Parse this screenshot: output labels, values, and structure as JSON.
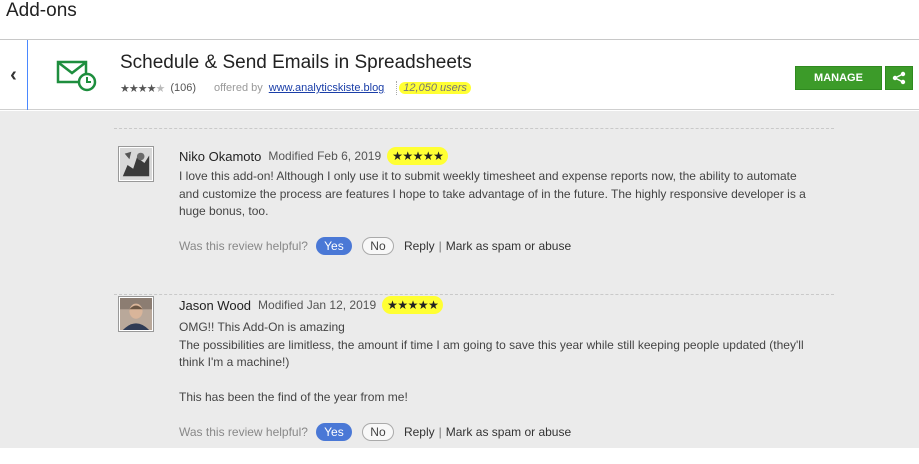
{
  "page": {
    "title": "Add-ons"
  },
  "addon": {
    "title": "Schedule & Send Emails in Spreadsheets",
    "stars_on": "★★★★",
    "stars_off": "★",
    "rating_count": "(106)",
    "offered_by": "offered by",
    "developer": "www.analyticskiste.blog",
    "users": "12,050 users",
    "manage_label": "MANAGE",
    "back_glyph": "‹"
  },
  "colors": {
    "accent_green": "#3c9b29",
    "highlight": "#ffff33",
    "yes_blue": "#4a78d6"
  },
  "icons": [
    "chevron-left-icon",
    "email-clock-icon",
    "share-icon"
  ],
  "reviews": [
    {
      "name": "Niko Okamoto",
      "modified": "Modified Feb 6, 2019",
      "stars": "★★★★★",
      "text": "I love this add-on! Although I only use it to submit weekly timesheet and expense reports now, the ability to automate and customize the process are features I hope to take advantage of in the future. The highly responsive developer is a huge bonus, too.",
      "helpful_q": "Was this review helpful?",
      "yes": "Yes",
      "no": "No",
      "reply": "Reply",
      "sep": "|",
      "spam": "Mark as spam or abuse"
    },
    {
      "name": "Jason Wood",
      "modified": "Modified Jan 12, 2019",
      "stars": "★★★★★",
      "text_lines": [
        "OMG!! This Add-On is amazing",
        "The possibilities are limitless, the amount if time I am going to save this year while still keeping people updated (they'll think I'm a machine!)",
        "",
        "This has been the find of the year from me!"
      ],
      "helpful_q": "Was this review helpful?",
      "yes": "Yes",
      "no": "No",
      "reply": "Reply",
      "sep": "|",
      "spam": "Mark as spam or abuse"
    }
  ]
}
